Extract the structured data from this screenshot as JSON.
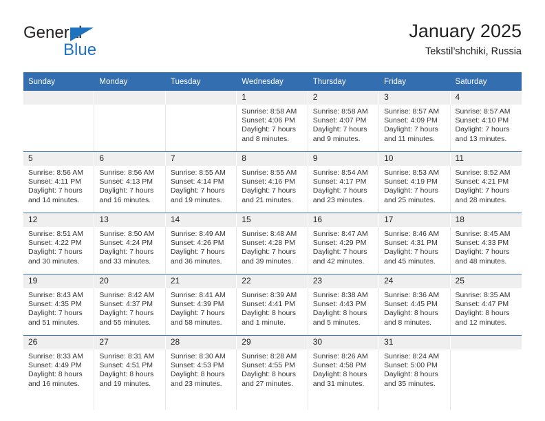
{
  "brand": {
    "name_top": "General",
    "name_bottom": "Blue",
    "accent_color": "#1f72bd",
    "triangle_icon": "triangle-icon"
  },
  "header": {
    "title": "January 2025",
    "subtitle": "Tekstil’shchiki, Russia"
  },
  "colors": {
    "header_row_bg": "#336fb0",
    "header_row_text": "#ffffff",
    "daynum_band_bg": "#efefef",
    "row_separator": "#336fb0",
    "cell_text": "#333333"
  },
  "calendar": {
    "weekday_headers": [
      "Sunday",
      "Monday",
      "Tuesday",
      "Wednesday",
      "Thursday",
      "Friday",
      "Saturday"
    ],
    "weeks": [
      [
        {
          "day": "",
          "lines": []
        },
        {
          "day": "",
          "lines": []
        },
        {
          "day": "",
          "lines": []
        },
        {
          "day": "1",
          "lines": [
            "Sunrise: 8:58 AM",
            "Sunset: 4:06 PM",
            "Daylight: 7 hours",
            "and 8 minutes."
          ]
        },
        {
          "day": "2",
          "lines": [
            "Sunrise: 8:58 AM",
            "Sunset: 4:07 PM",
            "Daylight: 7 hours",
            "and 9 minutes."
          ]
        },
        {
          "day": "3",
          "lines": [
            "Sunrise: 8:57 AM",
            "Sunset: 4:09 PM",
            "Daylight: 7 hours",
            "and 11 minutes."
          ]
        },
        {
          "day": "4",
          "lines": [
            "Sunrise: 8:57 AM",
            "Sunset: 4:10 PM",
            "Daylight: 7 hours",
            "and 13 minutes."
          ]
        }
      ],
      [
        {
          "day": "5",
          "lines": [
            "Sunrise: 8:56 AM",
            "Sunset: 4:11 PM",
            "Daylight: 7 hours",
            "and 14 minutes."
          ]
        },
        {
          "day": "6",
          "lines": [
            "Sunrise: 8:56 AM",
            "Sunset: 4:13 PM",
            "Daylight: 7 hours",
            "and 16 minutes."
          ]
        },
        {
          "day": "7",
          "lines": [
            "Sunrise: 8:55 AM",
            "Sunset: 4:14 PM",
            "Daylight: 7 hours",
            "and 19 minutes."
          ]
        },
        {
          "day": "8",
          "lines": [
            "Sunrise: 8:55 AM",
            "Sunset: 4:16 PM",
            "Daylight: 7 hours",
            "and 21 minutes."
          ]
        },
        {
          "day": "9",
          "lines": [
            "Sunrise: 8:54 AM",
            "Sunset: 4:17 PM",
            "Daylight: 7 hours",
            "and 23 minutes."
          ]
        },
        {
          "day": "10",
          "lines": [
            "Sunrise: 8:53 AM",
            "Sunset: 4:19 PM",
            "Daylight: 7 hours",
            "and 25 minutes."
          ]
        },
        {
          "day": "11",
          "lines": [
            "Sunrise: 8:52 AM",
            "Sunset: 4:21 PM",
            "Daylight: 7 hours",
            "and 28 minutes."
          ]
        }
      ],
      [
        {
          "day": "12",
          "lines": [
            "Sunrise: 8:51 AM",
            "Sunset: 4:22 PM",
            "Daylight: 7 hours",
            "and 30 minutes."
          ]
        },
        {
          "day": "13",
          "lines": [
            "Sunrise: 8:50 AM",
            "Sunset: 4:24 PM",
            "Daylight: 7 hours",
            "and 33 minutes."
          ]
        },
        {
          "day": "14",
          "lines": [
            "Sunrise: 8:49 AM",
            "Sunset: 4:26 PM",
            "Daylight: 7 hours",
            "and 36 minutes."
          ]
        },
        {
          "day": "15",
          "lines": [
            "Sunrise: 8:48 AM",
            "Sunset: 4:28 PM",
            "Daylight: 7 hours",
            "and 39 minutes."
          ]
        },
        {
          "day": "16",
          "lines": [
            "Sunrise: 8:47 AM",
            "Sunset: 4:29 PM",
            "Daylight: 7 hours",
            "and 42 minutes."
          ]
        },
        {
          "day": "17",
          "lines": [
            "Sunrise: 8:46 AM",
            "Sunset: 4:31 PM",
            "Daylight: 7 hours",
            "and 45 minutes."
          ]
        },
        {
          "day": "18",
          "lines": [
            "Sunrise: 8:45 AM",
            "Sunset: 4:33 PM",
            "Daylight: 7 hours",
            "and 48 minutes."
          ]
        }
      ],
      [
        {
          "day": "19",
          "lines": [
            "Sunrise: 8:43 AM",
            "Sunset: 4:35 PM",
            "Daylight: 7 hours",
            "and 51 minutes."
          ]
        },
        {
          "day": "20",
          "lines": [
            "Sunrise: 8:42 AM",
            "Sunset: 4:37 PM",
            "Daylight: 7 hours",
            "and 55 minutes."
          ]
        },
        {
          "day": "21",
          "lines": [
            "Sunrise: 8:41 AM",
            "Sunset: 4:39 PM",
            "Daylight: 7 hours",
            "and 58 minutes."
          ]
        },
        {
          "day": "22",
          "lines": [
            "Sunrise: 8:39 AM",
            "Sunset: 4:41 PM",
            "Daylight: 8 hours",
            "and 1 minute."
          ]
        },
        {
          "day": "23",
          "lines": [
            "Sunrise: 8:38 AM",
            "Sunset: 4:43 PM",
            "Daylight: 8 hours",
            "and 5 minutes."
          ]
        },
        {
          "day": "24",
          "lines": [
            "Sunrise: 8:36 AM",
            "Sunset: 4:45 PM",
            "Daylight: 8 hours",
            "and 8 minutes."
          ]
        },
        {
          "day": "25",
          "lines": [
            "Sunrise: 8:35 AM",
            "Sunset: 4:47 PM",
            "Daylight: 8 hours",
            "and 12 minutes."
          ]
        }
      ],
      [
        {
          "day": "26",
          "lines": [
            "Sunrise: 8:33 AM",
            "Sunset: 4:49 PM",
            "Daylight: 8 hours",
            "and 16 minutes."
          ]
        },
        {
          "day": "27",
          "lines": [
            "Sunrise: 8:31 AM",
            "Sunset: 4:51 PM",
            "Daylight: 8 hours",
            "and 19 minutes."
          ]
        },
        {
          "day": "28",
          "lines": [
            "Sunrise: 8:30 AM",
            "Sunset: 4:53 PM",
            "Daylight: 8 hours",
            "and 23 minutes."
          ]
        },
        {
          "day": "29",
          "lines": [
            "Sunrise: 8:28 AM",
            "Sunset: 4:55 PM",
            "Daylight: 8 hours",
            "and 27 minutes."
          ]
        },
        {
          "day": "30",
          "lines": [
            "Sunrise: 8:26 AM",
            "Sunset: 4:58 PM",
            "Daylight: 8 hours",
            "and 31 minutes."
          ]
        },
        {
          "day": "31",
          "lines": [
            "Sunrise: 8:24 AM",
            "Sunset: 5:00 PM",
            "Daylight: 8 hours",
            "and 35 minutes."
          ]
        },
        {
          "day": "",
          "lines": []
        }
      ]
    ]
  }
}
